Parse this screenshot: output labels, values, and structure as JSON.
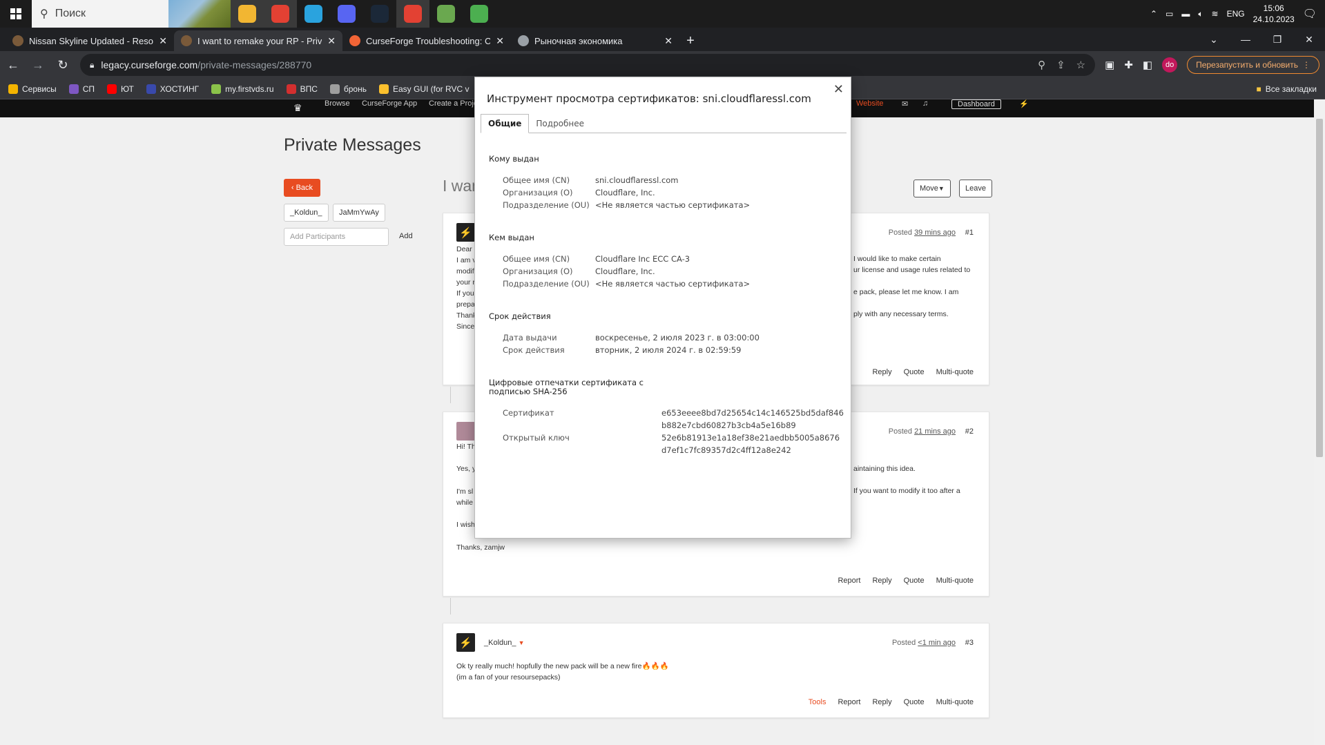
{
  "taskbar": {
    "search_label": "Поиск",
    "tray_lang": "ENG",
    "time": "15:06",
    "date": "24.10.2023",
    "apps": [
      {
        "name": "file-explorer-icon",
        "color": "#f2b632",
        "active": true
      },
      {
        "name": "chrome-icon",
        "color": "#e34133",
        "active": true
      },
      {
        "name": "telegram-icon",
        "color": "#2aa3de",
        "active": false
      },
      {
        "name": "discord-icon",
        "color": "#5865f2",
        "active": false
      },
      {
        "name": "steam-icon",
        "color": "#1b2838",
        "active": false
      },
      {
        "name": "chrome-profile-icon",
        "color": "#e34133",
        "active": true
      },
      {
        "name": "minecraft-launcher-icon",
        "color": "#6aa84f",
        "active": false
      },
      {
        "name": "minecraft-block-icon",
        "color": "#4caf50",
        "active": false
      }
    ]
  },
  "tabs": [
    {
      "title": "Nissan Skyline Updated - Resour",
      "active": false,
      "color": "#7a5a3a"
    },
    {
      "title": "I want to remake your RP - Priva",
      "active": true,
      "color": "#7a5a3a"
    },
    {
      "title": "CurseForge Troubleshooting: Cu",
      "active": false,
      "color": "#f16436"
    },
    {
      "title": "Рыночная экономика",
      "active": false,
      "color": "#9aa0a6"
    }
  ],
  "toolbar": {
    "url_host": "legacy.curseforge.com",
    "url_path": "/private-messages/288770",
    "profile_initials": "do",
    "update_label": "Перезапустить и обновить"
  },
  "bookmarks": [
    {
      "label": "Сервисы",
      "color": "#f4b400"
    },
    {
      "label": "СП",
      "color": "#7e57c2"
    },
    {
      "label": "ЮТ",
      "color": "#ff0000"
    },
    {
      "label": "ХОСТИНГ",
      "color": "#3949ab"
    },
    {
      "label": "my.firstvds.ru",
      "color": "#8bc34a"
    },
    {
      "label": "ВПС",
      "color": "#d32f2f"
    },
    {
      "label": "бронь",
      "color": "#9e9e9e"
    },
    {
      "label": "Easy GUI (for RVC v",
      "color": "#fbc02d"
    }
  ],
  "bookmarks_all": "Все закладки",
  "site": {
    "nav": [
      "Browse",
      "CurseForge App",
      "Create a Project"
    ],
    "nav_right": "Website",
    "dashboard": "Dashboard"
  },
  "page": {
    "title": "Private Messages",
    "back": "Back",
    "participants": [
      "_Koldun_",
      "JaMmYwAy"
    ],
    "add_placeholder": "Add Participants",
    "add_label": "Add",
    "message_title": "I wan",
    "move": "Move",
    "leave": "Leave"
  },
  "posts": [
    {
      "num": "#1",
      "posted_prefix": "Posted",
      "posted_time": "39 mins ago",
      "left_lines": [
        "Dear",
        "I am v",
        "modif",
        "your r",
        "If you",
        "prepa",
        "Thank",
        "Since"
      ],
      "right_lines": [
        "I would like to make certain",
        "ur license and usage rules related to",
        "",
        "e pack, please let me know. I am",
        "",
        "ply with any necessary terms."
      ],
      "actions": [
        "Reply",
        "Quote",
        "Multi-quote"
      ]
    },
    {
      "num": "#2",
      "posted_prefix": "Posted",
      "posted_time": "21 mins ago",
      "left_lines": [
        "Hi! Th",
        "",
        "Yes, y",
        "",
        "I'm sl",
        "while",
        "",
        "I wish",
        "",
        "Thanks, zamjw"
      ],
      "right_lines": [
        "aintaining this idea.",
        "",
        "If you want to modify it too after a"
      ],
      "actions": [
        "Report",
        "Reply",
        "Quote",
        "Multi-quote"
      ]
    },
    {
      "num": "#3",
      "user": "_Koldun_",
      "posted_prefix": "Posted",
      "posted_time": "<1 min ago",
      "lines": [
        "Ok ty really much! hopfully the new pack will be a new fire🔥🔥🔥",
        "(im a fan of your resoursepacks)"
      ],
      "actions": [
        "Tools",
        "Report",
        "Reply",
        "Quote",
        "Multi-quote"
      ]
    }
  ],
  "dialog": {
    "title": "Инструмент просмотра сертификатов: sni.cloudflaressl.com",
    "tabs": [
      "Общие",
      "Подробнее"
    ],
    "issued_to": {
      "heading": "Кому выдан",
      "rows": [
        {
          "k": "Общее имя (CN)",
          "v": "sni.cloudflaressl.com"
        },
        {
          "k": "Организация (O)",
          "v": "Cloudflare, Inc."
        },
        {
          "k": "Подразделение (OU)",
          "v": "<Не является частью сертификата>"
        }
      ]
    },
    "issued_by": {
      "heading": "Кем выдан",
      "rows": [
        {
          "k": "Общее имя (CN)",
          "v": "Cloudflare Inc ECC CA-3"
        },
        {
          "k": "Организация (O)",
          "v": "Cloudflare, Inc."
        },
        {
          "k": "Подразделение (OU)",
          "v": "<Не является частью сертификата>"
        }
      ]
    },
    "validity": {
      "heading": "Срок действия",
      "rows": [
        {
          "k": "Дата выдачи",
          "v": "воскресенье, 2 июля 2023 г. в 03:00:00"
        },
        {
          "k": "Срок действия",
          "v": "вторник, 2 июля 2024 г. в 02:59:59"
        }
      ]
    },
    "fingerprints": {
      "heading_line1": "Цифровые отпечатки сертификата с",
      "heading_line2": "подписью SHA-256",
      "rows": [
        {
          "k": "Сертификат",
          "v": "e653eeee8bd7d25654c14c146525bd5daf846b882e7cbd60827b3cb4a5e16b89"
        },
        {
          "k": "Открытый ключ",
          "v": "52e6b81913e1a18ef38e21aedbb5005a8676d7ef1c7fc89357d2c4ff12a8e242"
        }
      ]
    }
  }
}
